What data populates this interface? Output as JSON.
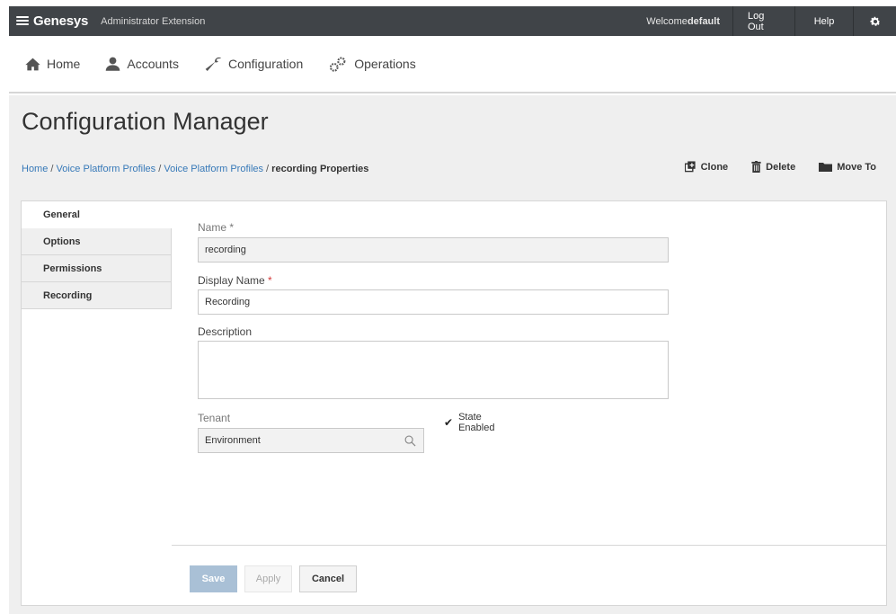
{
  "topbar": {
    "brand": "Genesys",
    "app_name": "Administrator Extension",
    "welcome_prefix": "Welcome ",
    "welcome_user": "default",
    "logout_label": "Log Out",
    "help_label": "Help",
    "settings_icon": "gear-icon"
  },
  "nav": {
    "items": [
      {
        "label": "Home",
        "icon": "home-icon"
      },
      {
        "label": "Accounts",
        "icon": "user-icon"
      },
      {
        "label": "Configuration",
        "icon": "wrench-icon"
      },
      {
        "label": "Operations",
        "icon": "gears-icon"
      }
    ]
  },
  "page": {
    "title": "Configuration Manager"
  },
  "breadcrumb": {
    "links": [
      "Home",
      "Voice Platform Profiles",
      "Voice Platform Profiles"
    ],
    "separator": " / ",
    "current": "recording Properties"
  },
  "actions": {
    "clone": "Clone",
    "delete": "Delete",
    "move_to": "Move To"
  },
  "tabs": [
    "General",
    "Options",
    "Permissions",
    "Recording"
  ],
  "active_tab": "General",
  "form": {
    "name_label": "Name",
    "name_value": "recording",
    "display_name_label": "Display Name",
    "display_name_value": "Recording",
    "required_marker": "*",
    "description_label": "Description",
    "description_value": "",
    "tenant_label": "Tenant",
    "tenant_value": "Environment",
    "state_enabled_label": "State Enabled",
    "state_enabled_checked": true
  },
  "buttons": {
    "save": "Save",
    "apply": "Apply",
    "cancel": "Cancel"
  },
  "colors": {
    "topbar_bg": "#404448",
    "link": "#3779b8",
    "required": "#d43a3a",
    "save_disabled": "#a9c0d6",
    "content_bg": "#efefef"
  }
}
